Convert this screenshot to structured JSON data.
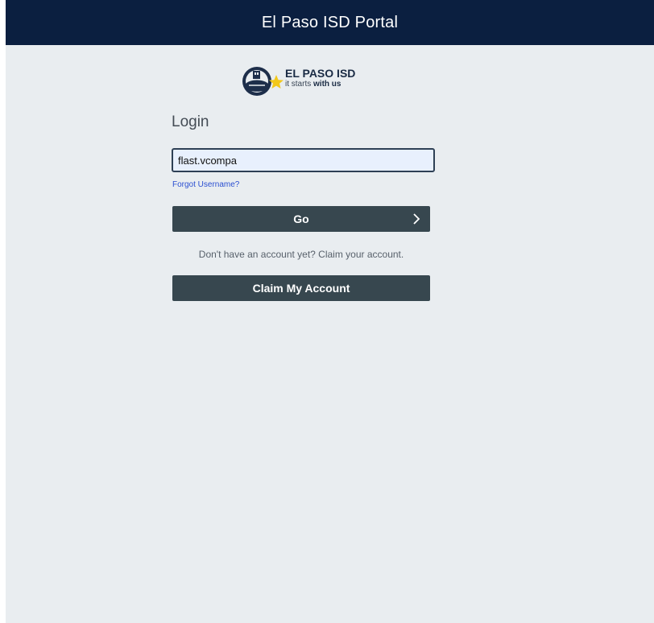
{
  "header": {
    "title": "El Paso ISD Portal",
    "background": "#0b1f40"
  },
  "logo": {
    "name": "EL PASO ISD",
    "tagline_prefix": "it starts ",
    "tagline_bold": "with us",
    "icon": "el-paso-isd-logo-mark"
  },
  "login": {
    "heading": "Login",
    "username_value": "flast.vcompa",
    "forgot_username": "Forgot Username?",
    "go_label": "Go",
    "go_icon": "chevron-right-icon",
    "claim_prompt": "Don't have an account yet? Claim your account.",
    "claim_label": "Claim My Account"
  },
  "colors": {
    "page_background": "#e9edf0",
    "button": "#37474f",
    "link": "#2b4fd1",
    "input_background": "#e8f0fd"
  }
}
